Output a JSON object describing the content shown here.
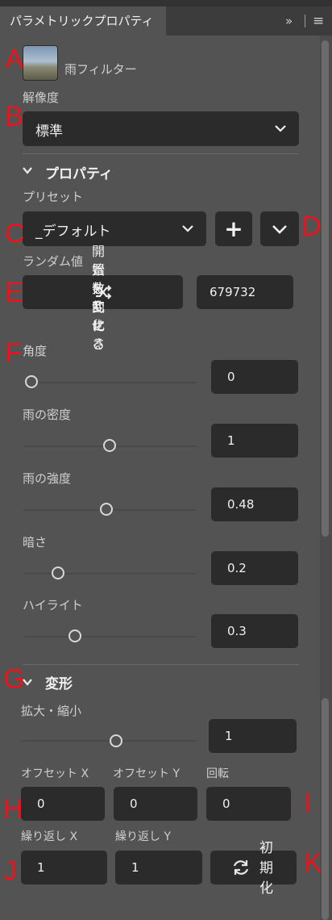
{
  "panel": {
    "tab_title": "パラメトリックプロパティ",
    "tab_tools_chevron": "»",
    "tab_menu_icon": "≡"
  },
  "filter": {
    "name": "雨フィルター",
    "thumbnail": "mountain-landscape-thumbnail"
  },
  "resolution": {
    "label": "解像度",
    "value": "標準"
  },
  "properties_section": {
    "title": "プロパティ",
    "preset_label": "プリセット",
    "preset_value": "_デフォルト",
    "add_symbol": "+",
    "random_label": "ランダム値",
    "shuffle_tooltip": "開始位置を乱数的に変化させる",
    "shuffle_tooltip_lines": [
      "開始位",
      "置を乱",
      "数的に",
      "変化さ",
      "せる"
    ],
    "random_value": "679732",
    "sliders": [
      {
        "label": "角度",
        "value": "0",
        "level": 0.0
      },
      {
        "label": "雨の密度",
        "value": "1",
        "level": 0.5
      },
      {
        "label": "雨の強度",
        "value": "0.48",
        "level": 0.48
      },
      {
        "label": "暗さ",
        "value": "0.2",
        "level": 0.2
      },
      {
        "label": "ハイライト",
        "value": "0.3",
        "level": 0.3
      }
    ]
  },
  "transform_section": {
    "title": "変形",
    "scale_label": "拡大・縮小",
    "scale_value": "1",
    "scale_level": 0.5,
    "offset_x_label": "オフセット X",
    "offset_x_value": "0",
    "offset_y_label": "オフセット Y",
    "offset_y_value": "0",
    "rotation_label": "回転",
    "rotation_value": "0",
    "repeat_x_label": "繰り返し X",
    "repeat_x_value": "1",
    "repeat_y_label": "繰り返し Y",
    "repeat_y_value": "1",
    "reset_label": "初期化",
    "reset_label_lines": [
      "初",
      "期",
      "化"
    ]
  },
  "annotations": [
    "A",
    "B",
    "C",
    "D",
    "E",
    "F",
    "G",
    "H",
    "I",
    "J",
    "K"
  ],
  "colors": {
    "panel_bg": "#535353",
    "field_bg": "#2b2b2b",
    "annotation_red": "#e8161c"
  }
}
